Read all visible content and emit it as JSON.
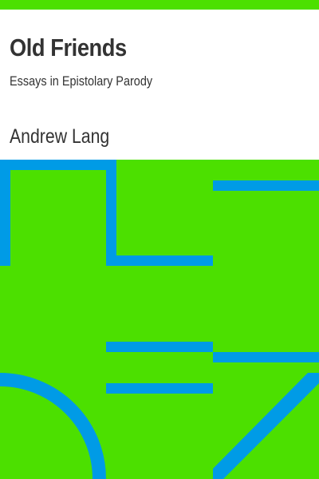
{
  "cover": {
    "title": "Old Friends",
    "subtitle": "Essays in Epistolary Parody",
    "author": "Andrew Lang"
  },
  "colors": {
    "background": "#4ce000",
    "pattern": "#009be6",
    "text": "#333333",
    "title_panel": "#ffffff"
  }
}
